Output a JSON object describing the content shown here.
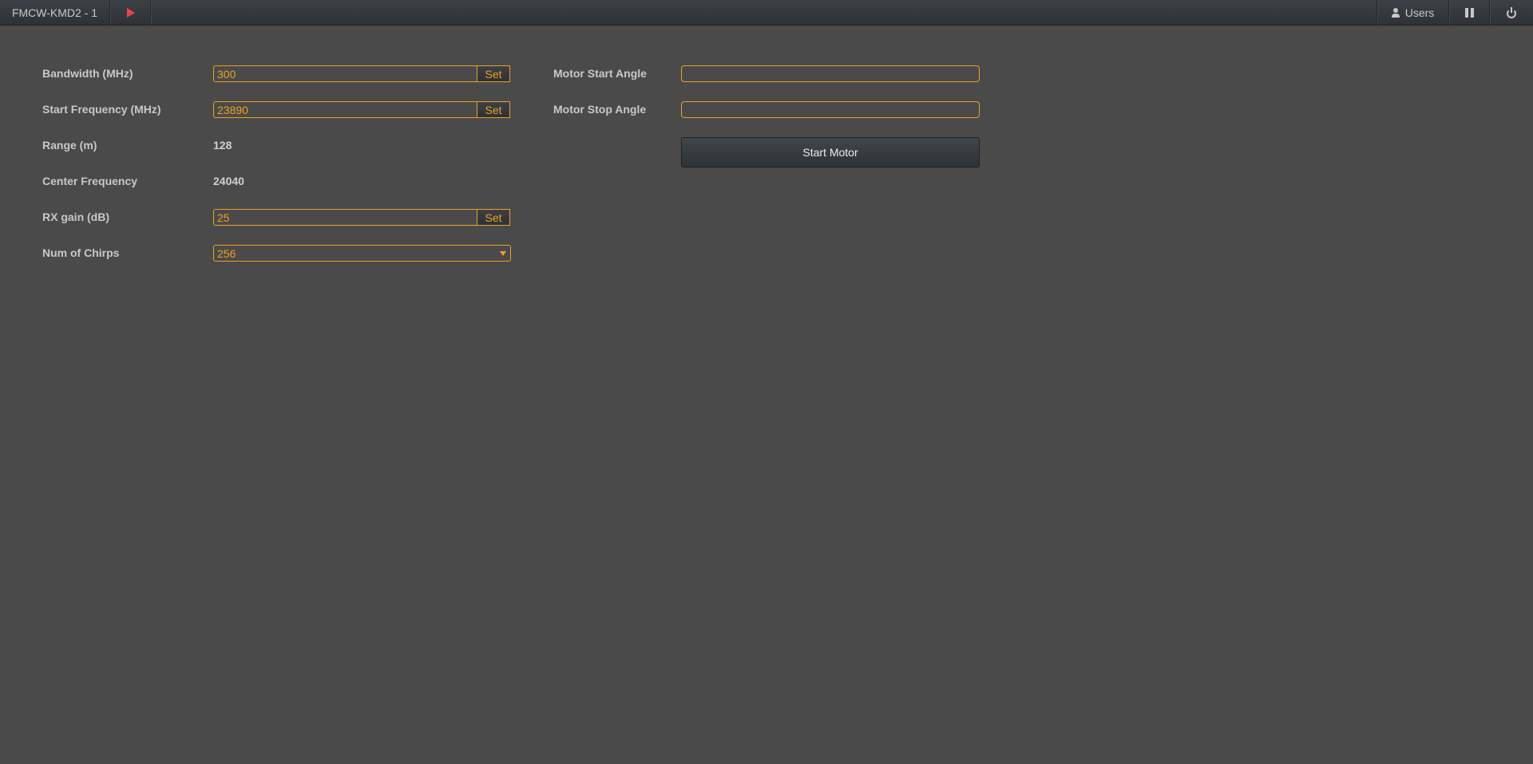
{
  "topbar": {
    "title": "FMCW-KMD2 - 1",
    "play_icon": "play-icon",
    "users_label": "Users",
    "users_icon": "user-icon",
    "pause_icon": "pause-icon",
    "power_icon": "power-icon",
    "play_color": "#e8454a"
  },
  "accent_color": "#f0a020",
  "left_panel": {
    "bandwidth": {
      "label": "Bandwidth (MHz)",
      "value": "300",
      "button": "Set"
    },
    "start_frequency": {
      "label": "Start Frequency (MHz)",
      "value": "23890",
      "button": "Set"
    },
    "range": {
      "label": "Range (m)",
      "value": "128"
    },
    "center_frequency": {
      "label": "Center Frequency",
      "value": "24040"
    },
    "rx_gain": {
      "label": "RX gain (dB)",
      "value": "25",
      "button": "Set"
    },
    "num_chirps": {
      "label": "Num of Chirps",
      "selected": "256"
    }
  },
  "right_panel": {
    "motor_start_angle": {
      "label": "Motor Start Angle",
      "value": ""
    },
    "motor_stop_angle": {
      "label": "Motor Stop Angle",
      "value": ""
    },
    "start_motor_button": "Start Motor"
  }
}
